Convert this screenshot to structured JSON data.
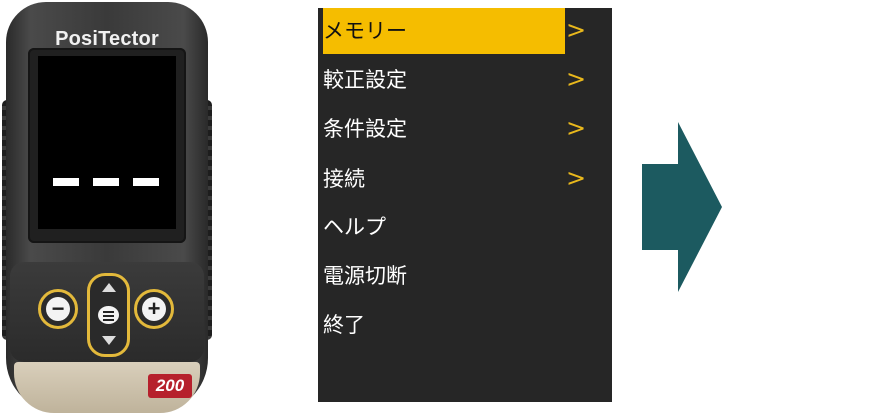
{
  "device": {
    "brand": "PosiTector",
    "model": "200",
    "buttons": {
      "minus": "−",
      "plus": "+"
    }
  },
  "menu": {
    "items": [
      {
        "label": "メモリー",
        "submenu": true,
        "selected": true
      },
      {
        "label": "較正設定",
        "submenu": true,
        "selected": false
      },
      {
        "label": "条件設定",
        "submenu": true,
        "selected": false
      },
      {
        "label": "接続",
        "submenu": true,
        "selected": false
      },
      {
        "label": "ヘルプ",
        "submenu": false,
        "selected": false
      },
      {
        "label": "電源切断",
        "submenu": false,
        "selected": false
      },
      {
        "label": "終了",
        "submenu": false,
        "selected": false
      }
    ],
    "arrow_glyph": ">"
  },
  "colors": {
    "highlight": "#f5bd00",
    "arrow_accent": "#e9b81c",
    "panel_bg": "#262626",
    "big_arrow": "#1c5a60"
  },
  "icons": [
    "minus-icon",
    "plus-icon",
    "up-triangle-icon",
    "down-triangle-icon",
    "menu-lines-icon",
    "right-arrow-icon"
  ]
}
